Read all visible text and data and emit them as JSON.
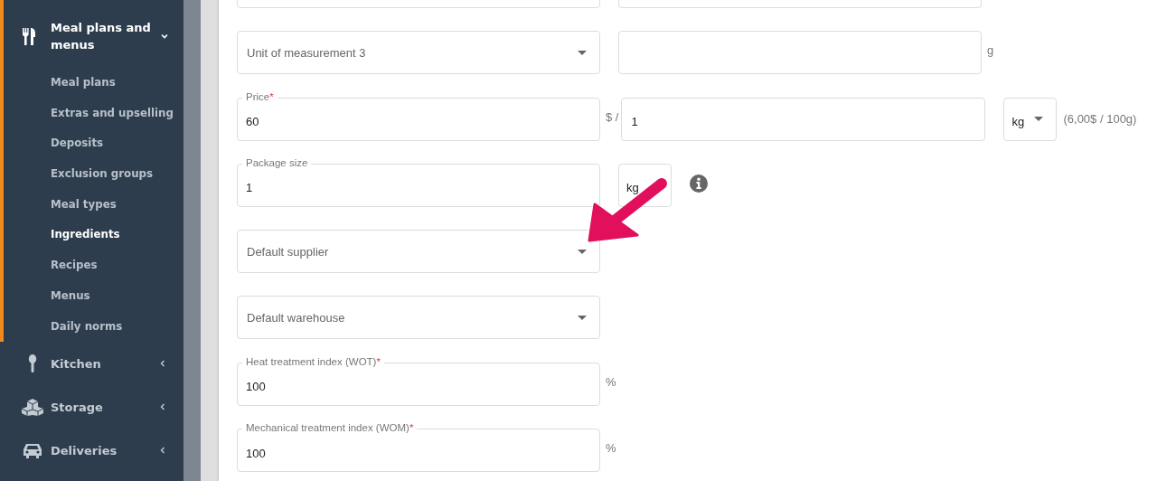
{
  "sidebar": {
    "groups": [
      {
        "label": "Meal plans and menus",
        "selected": true,
        "expanded": true,
        "items": [
          {
            "label": "Meal plans",
            "selected": false
          },
          {
            "label": "Extras and upselling",
            "selected": false
          },
          {
            "label": "Deposits",
            "selected": false
          },
          {
            "label": "Exclusion groups",
            "selected": false
          },
          {
            "label": "Meal types",
            "selected": false
          },
          {
            "label": "Ingredients",
            "selected": true
          },
          {
            "label": "Recipes",
            "selected": false
          },
          {
            "label": "Menus",
            "selected": false
          },
          {
            "label": "Daily norms",
            "selected": false
          }
        ]
      },
      {
        "label": "Kitchen",
        "selected": false,
        "expanded": false
      },
      {
        "label": "Storage",
        "selected": false,
        "expanded": false
      },
      {
        "label": "Deliveries",
        "selected": false,
        "expanded": false
      }
    ]
  },
  "form": {
    "rows": [
      {
        "fields": [
          {
            "kind": "input"
          },
          {
            "kind": "input"
          }
        ]
      },
      {
        "fields": [
          {
            "kind": "select",
            "placeholder": "Unit of measurement 3"
          },
          {
            "kind": "input"
          },
          {
            "kind": "suffix",
            "text": "g"
          }
        ]
      },
      {
        "fields": [
          {
            "kind": "input",
            "label": "Price",
            "required_mark": "*",
            "value": "60"
          },
          {
            "kind": "suffix",
            "text": "$ /"
          },
          {
            "kind": "input",
            "value": "1"
          },
          {
            "kind": "unit-select",
            "value": "kg"
          },
          {
            "kind": "suffix",
            "text": "(6,00$ / 100g)"
          }
        ]
      },
      {
        "fields": [
          {
            "kind": "input",
            "label": "Package size",
            "value": "1"
          },
          {
            "kind": "unit",
            "text": "kg"
          },
          {
            "kind": "info"
          }
        ]
      },
      {
        "fields": [
          {
            "kind": "select",
            "placeholder": "Default supplier"
          }
        ]
      },
      {
        "fields": [
          {
            "kind": "select",
            "placeholder": "Default warehouse"
          }
        ]
      },
      {
        "fields": [
          {
            "kind": "input",
            "label": "Heat treatment index (WOT)",
            "required_mark": "*",
            "value": "100"
          },
          {
            "kind": "suffix",
            "text": "%"
          }
        ]
      },
      {
        "fields": [
          {
            "kind": "input",
            "label": "Mechanical treatment index (WOM)",
            "required_mark": "*",
            "value": "100"
          },
          {
            "kind": "suffix",
            "text": "%"
          }
        ]
      }
    ]
  }
}
